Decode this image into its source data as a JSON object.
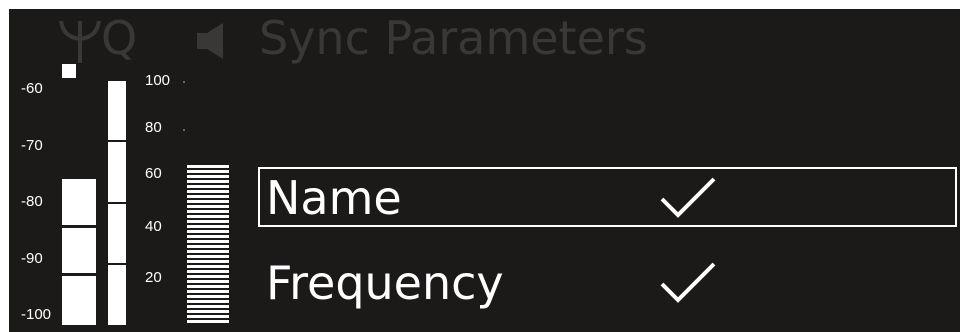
{
  "header": {
    "title": "Sync Parameters",
    "q_letter": "Q",
    "antenna_icon": "antenna-icon",
    "speaker_icon": "speaker-icon"
  },
  "rf_meter": {
    "scale": [
      "-60",
      "-70",
      "-80",
      "-90",
      "-100"
    ],
    "bar_segments": 3
  },
  "af_meter": {
    "scale": [
      "100",
      "80",
      "60",
      "40",
      "20"
    ]
  },
  "menu": {
    "items": [
      {
        "label": "Name",
        "checked": true,
        "selected": true,
        "check_icon": "checkmark-icon"
      },
      {
        "label": "Frequency",
        "checked": true,
        "selected": false,
        "check_icon": "checkmark-icon"
      }
    ]
  },
  "colors": {
    "background": "#1c1a19",
    "foreground": "#ffffff",
    "dimmed": "#3a3836"
  }
}
